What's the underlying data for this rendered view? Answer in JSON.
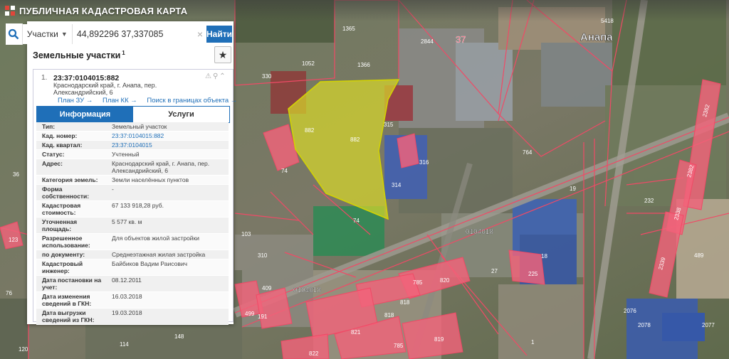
{
  "app": {
    "title": "ПУБЛИЧНАЯ КАДАСТРОВАЯ КАРТА"
  },
  "search": {
    "type_label": "Участки",
    "value": "44,892296 37,337085",
    "find_label": "Найти",
    "clear_icon": "close-icon",
    "search_icon": "search-icon"
  },
  "panel": {
    "title": "Земельные участки",
    "count_sup": "1"
  },
  "result": {
    "index": "1.",
    "cad_number": "23:37:0104015:882",
    "address": "Краснодарский край, г. Анапа, пер. Александрийский, 6",
    "links": [
      "План ЗУ →",
      "План КК →",
      "Поиск в границах объекта →"
    ],
    "tabs": [
      "Информация",
      "Услуги"
    ]
  },
  "info": [
    {
      "key": "Тип:",
      "value": "Земельный участок",
      "link": false
    },
    {
      "key": "Кад. номер:",
      "value": "23:37:0104015:882",
      "link": true
    },
    {
      "key": "Кад. квартал:",
      "value": "23:37:0104015",
      "link": true
    },
    {
      "key": "Статус:",
      "value": "Учтенный",
      "link": false
    },
    {
      "key": "Адрес:",
      "value": "Краснодарский край, г. Анапа, пер. Александрийский, 6",
      "link": false
    },
    {
      "key": "Категория земель:",
      "value": "Земли населённых пунктов",
      "link": false
    },
    {
      "key": "Форма собственности:",
      "value": "-",
      "link": false
    },
    {
      "key": "Кадастровая стоимость:",
      "value": "67 133 918,28 руб.",
      "link": false
    },
    {
      "key": "Уточненная площадь:",
      "value": "5 577 кв. м",
      "link": false
    },
    {
      "key": "Разрешенное использование:",
      "value": "Для объектов жилой застройки",
      "link": false
    },
    {
      "key": "по документу:",
      "value": "Среднеэтажная жилая застройка",
      "link": false
    },
    {
      "key": "Кадастровый инженер:",
      "value": "Байбиков Вадим Раисович",
      "link": false
    },
    {
      "key": "Дата постановки на учет:",
      "value": "08.12.2011",
      "link": false
    },
    {
      "key": "Дата изменения сведений в ГКН:",
      "value": "16.03.2018",
      "link": false
    },
    {
      "key": "Дата выгрузки сведений из ГКН:",
      "value": "19.03.2018",
      "link": false
    }
  ],
  "map_labels": {
    "city": "Анапа",
    "quarter_37": "37",
    "quarter_a": "0104018",
    "quarter_b": "0104018",
    "parcels": [
      "1365",
      "2844",
      "5418",
      "1366",
      "1052",
      "330",
      "315",
      "316",
      "314",
      "882",
      "882",
      "74",
      "74",
      "764",
      "19",
      "232",
      "2362",
      "2382",
      "2338",
      "2339",
      "489",
      "18",
      "225",
      "27",
      "785",
      "820",
      "818",
      "818",
      "821",
      "819",
      "822",
      "785",
      "148",
      "114",
      "120",
      "310",
      "409",
      "499",
      "191",
      "76",
      "103",
      "123",
      "36",
      "37",
      "2076",
      "2078",
      "2077",
      "1"
    ]
  },
  "colors": {
    "accent": "#1f6fb8",
    "parcel_fill": "#f2637a",
    "selected_fill": "#d8d82a"
  }
}
